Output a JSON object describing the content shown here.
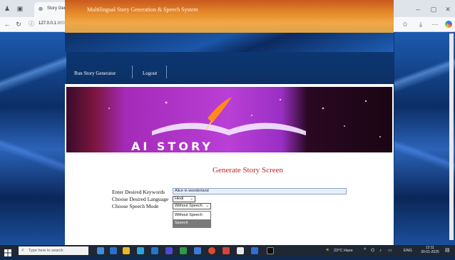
{
  "browser": {
    "tab_title": "Story Generator",
    "tab_close": "×",
    "new_tab": "+",
    "url_host": "127.0.0.1",
    "url_path": ":8000/GenerateStory",
    "window_controls": {
      "minimize": "–",
      "maximize": "▢",
      "close": "✕"
    },
    "icons": [
      "back-icon",
      "forward-icon",
      "reload-icon",
      "info-icon",
      "favorite-star-icon",
      "favorites-icon",
      "downloads-icon",
      "more-icon",
      "copilot-icon"
    ]
  },
  "site": {
    "banner_title": "Multilingual Story Generation & Speech System",
    "nav": [
      "Run Story Generator",
      "Logout"
    ],
    "hero_text": "AI STORY"
  },
  "form": {
    "title": "Generate Story Screen",
    "keywords_label": "Enter Desired Keywords",
    "keywords_value": "Alice in wonderland",
    "language_label": "Choose Desired Language",
    "language_value": "Hindi",
    "speech_label": "Choose Speech Mode",
    "speech_value": "Without Speech",
    "speech_options": [
      "Without Speech",
      "Speech"
    ],
    "highlighted_option": "Speech"
  },
  "taskbar": {
    "search_placeholder": "Type here to search",
    "weather": "23°C Haze",
    "language": "ENG",
    "time": "12:11",
    "date": "30-01-2025"
  },
  "colors": {
    "form_title": "#b3262c",
    "highlight": "#7a7a7a",
    "banner": "#e58a2a"
  }
}
